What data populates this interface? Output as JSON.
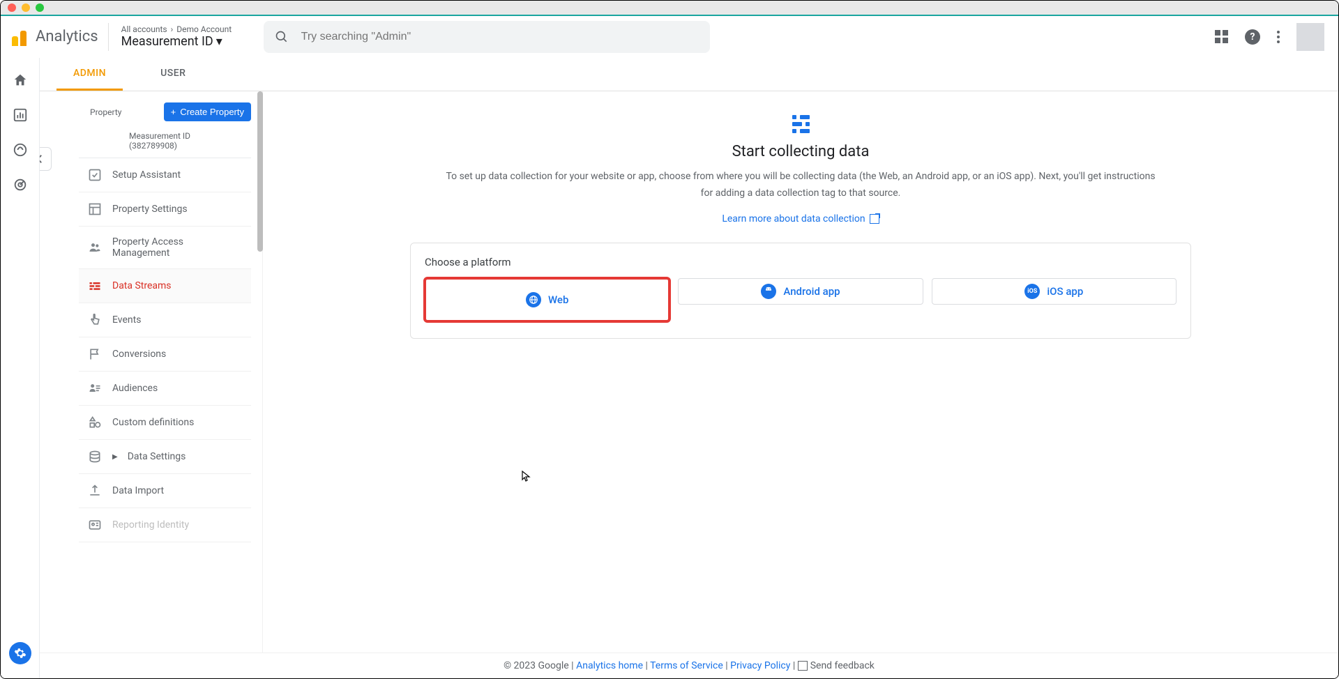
{
  "header": {
    "product": "Analytics",
    "breadcrumb_top_1": "All accounts",
    "breadcrumb_top_2": "Demo Account",
    "breadcrumb_bottom": "Measurement ID",
    "search_placeholder": "Try searching \"Admin\""
  },
  "tabs": {
    "admin": "ADMIN",
    "user": "USER"
  },
  "sidebar": {
    "property_label": "Property",
    "create_button": "Create Property",
    "property_name": "Measurement ID (382789908)",
    "items": [
      {
        "label": "Setup Assistant"
      },
      {
        "label": "Property Settings"
      },
      {
        "label": "Property Access Management"
      },
      {
        "label": "Data Streams"
      },
      {
        "label": "Events"
      },
      {
        "label": "Conversions"
      },
      {
        "label": "Audiences"
      },
      {
        "label": "Custom definitions"
      },
      {
        "label": "Data Settings"
      },
      {
        "label": "Data Import"
      },
      {
        "label": "Reporting Identity"
      }
    ]
  },
  "main": {
    "title": "Start collecting data",
    "description": "To set up data collection for your website or app, choose from where you will be collecting data (the Web, an Android app, or an iOS app). Next, you'll get instructions for adding a data collection tag to that source.",
    "learn_more": "Learn more about data collection",
    "card_label": "Choose a platform",
    "platforms": {
      "web": "Web",
      "android": "Android app",
      "ios": "iOS app"
    }
  },
  "footer": {
    "copyright": "© 2023 Google",
    "home": "Analytics home",
    "tos": "Terms of Service",
    "privacy": "Privacy Policy",
    "feedback": "Send feedback"
  }
}
